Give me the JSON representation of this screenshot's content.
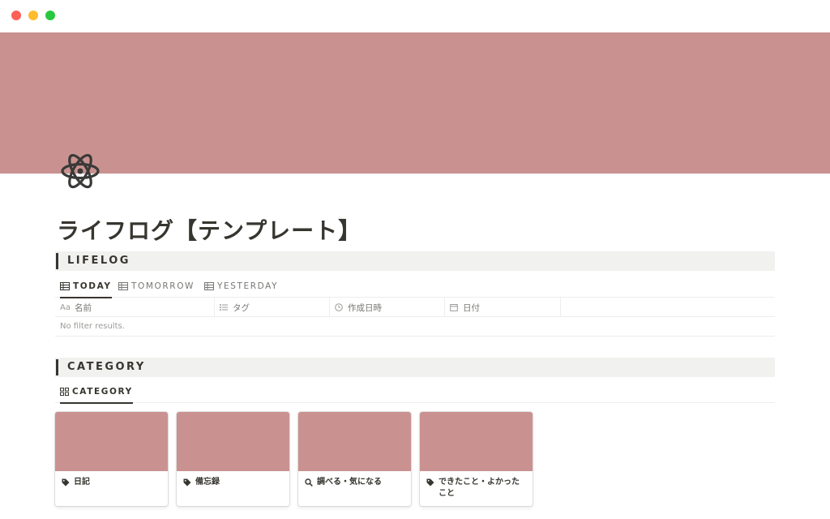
{
  "page": {
    "title": "ライフログ【テンプレート】",
    "icon": "atom-icon",
    "cover_color": "#c99291"
  },
  "lifelog": {
    "heading": "LIFELOG",
    "tabs": [
      {
        "label": "TODAY",
        "icon": "table-icon",
        "active": true
      },
      {
        "label": "TOMORROW",
        "icon": "table-icon",
        "active": false
      },
      {
        "label": "YESTERDAY",
        "icon": "table-icon",
        "active": false
      }
    ],
    "columns": [
      {
        "label": "名前",
        "icon": "aa-text-icon"
      },
      {
        "label": "タグ",
        "icon": "list-icon"
      },
      {
        "label": "作成日時",
        "icon": "clock-icon"
      },
      {
        "label": "日付",
        "icon": "calendar-icon"
      }
    ],
    "empty_text": "No filter results."
  },
  "category": {
    "heading": "CATEGORY",
    "tabs": [
      {
        "label": "CATEGORY",
        "icon": "gallery-icon",
        "active": true
      }
    ],
    "cards": [
      {
        "title": "日記",
        "icon": "tag-icon"
      },
      {
        "title": "備忘録",
        "icon": "tag-icon"
      },
      {
        "title": "調べる・気になる",
        "icon": "magnifier-icon"
      },
      {
        "title": "できたこと・よかったこと",
        "icon": "tag-icon"
      }
    ]
  }
}
